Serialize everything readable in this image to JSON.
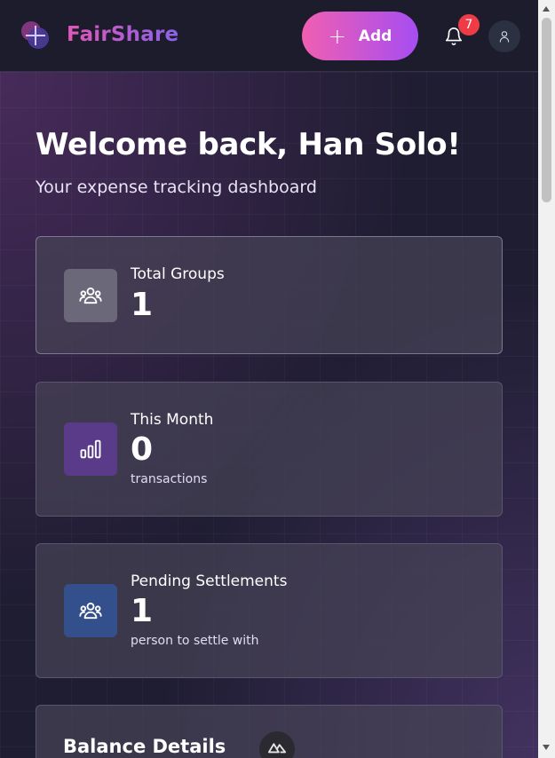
{
  "header": {
    "brand": "FairShare",
    "add_label": "Add",
    "notification_count": "7",
    "icons": {
      "logo": "fairshare-logo-icon",
      "add": "plus-icon",
      "bell": "bell-icon",
      "avatar": "user-icon"
    }
  },
  "main": {
    "welcome": "Welcome back, Han Solo!",
    "subtitle": "Your expense tracking dashboard",
    "cards": [
      {
        "label": "Total Groups",
        "value": "1",
        "icon": "users-icon"
      },
      {
        "label": "This Month",
        "value": "0",
        "sub": "transactions",
        "icon": "bar-chart-icon"
      },
      {
        "label": "Pending Settlements",
        "value": "1",
        "sub": "person to settle with",
        "icon": "users-icon"
      }
    ],
    "balance_title": "Balance Details"
  },
  "colors": {
    "accent_pink": "#f05fb1",
    "accent_purple": "#a64df2",
    "badge_red": "#ee3b46"
  }
}
